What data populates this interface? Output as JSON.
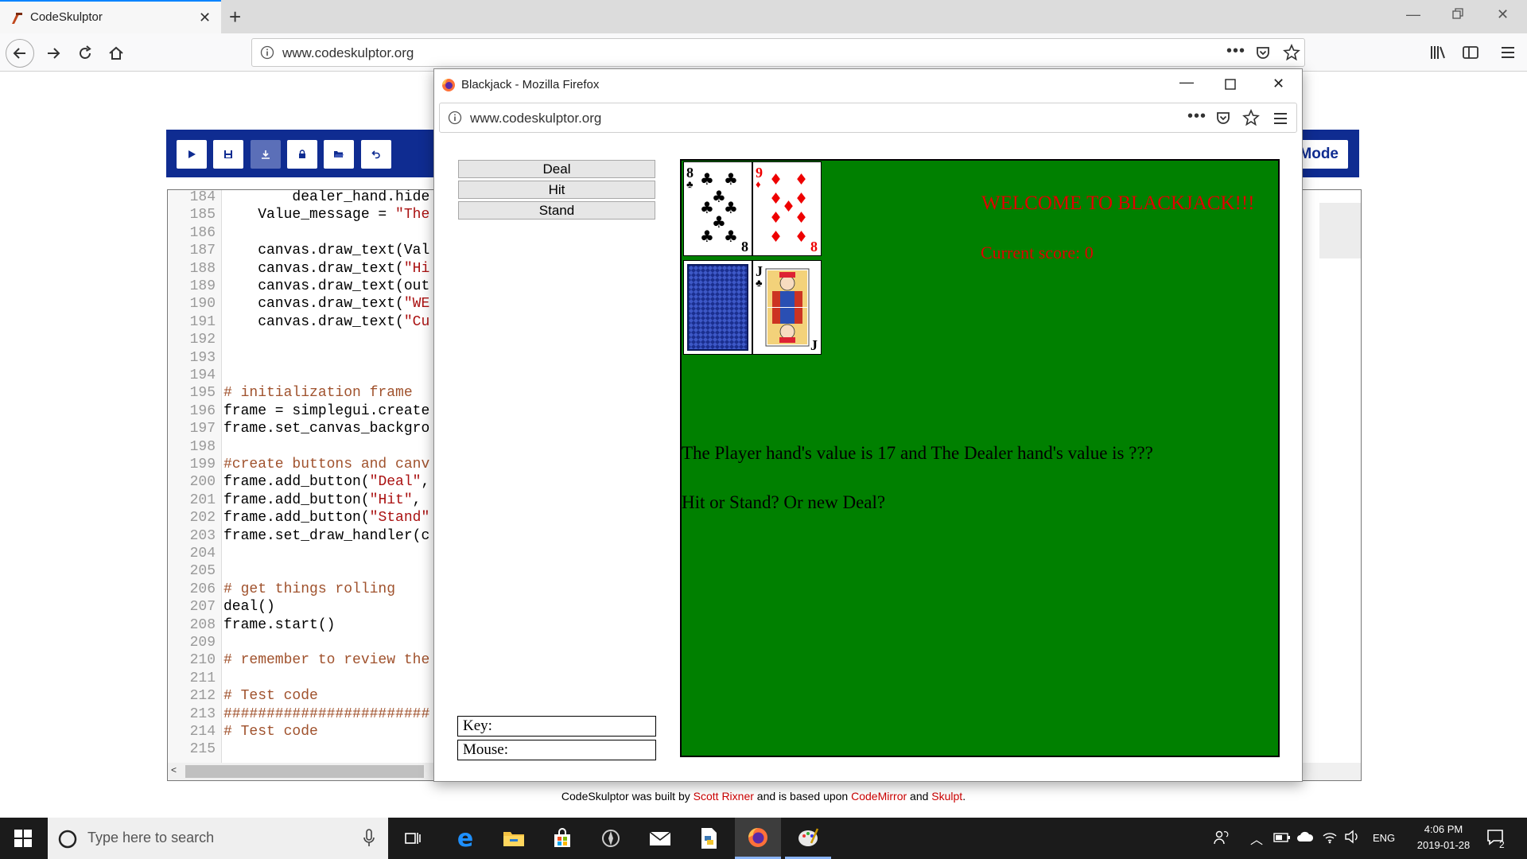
{
  "browser": {
    "tab_title": "CodeSkulptor",
    "url": "www.codeskulptor.org"
  },
  "codeskulptor": {
    "mode_label": "Mode",
    "toolbar_icons": [
      "run-icon",
      "save-icon",
      "download-icon",
      "lock-icon",
      "open-folder-icon",
      "undo-icon"
    ],
    "code_lines": [
      {
        "n": "184",
        "t": "        dealer_hand.hide",
        "k": "code"
      },
      {
        "n": "185",
        "t": "    Value_message = ",
        "s": "\"The",
        "k": "code"
      },
      {
        "n": "186",
        "t": "",
        "k": "code"
      },
      {
        "n": "187",
        "t": "    canvas.draw_text(Val",
        "k": "code"
      },
      {
        "n": "188",
        "t": "    canvas.draw_text(",
        "s": "\"Hi",
        "k": "code"
      },
      {
        "n": "189",
        "t": "    canvas.draw_text(out",
        "k": "code"
      },
      {
        "n": "190",
        "t": "    canvas.draw_text(",
        "s": "\"WE",
        "k": "code"
      },
      {
        "n": "191",
        "t": "    canvas.draw_text(",
        "s": "\"Cu",
        "k": "code"
      },
      {
        "n": "192",
        "t": "",
        "k": "code"
      },
      {
        "n": "193",
        "t": "",
        "k": "code"
      },
      {
        "n": "194",
        "t": "",
        "k": "code"
      },
      {
        "n": "195",
        "t": "# initialization frame",
        "k": "comment"
      },
      {
        "n": "196",
        "t": "frame = simplegui.create",
        "k": "code"
      },
      {
        "n": "197",
        "t": "frame.set_canvas_backgro",
        "k": "code"
      },
      {
        "n": "198",
        "t": "",
        "k": "code"
      },
      {
        "n": "199",
        "t": "#create buttons and canv",
        "k": "comment"
      },
      {
        "n": "200",
        "t": "frame.add_button(",
        "s": "\"Deal\"",
        "r": ",",
        "k": "code"
      },
      {
        "n": "201",
        "t": "frame.add_button(",
        "s": "\"Hit\"",
        "r": ",",
        "k": "code"
      },
      {
        "n": "202",
        "t": "frame.add_button(",
        "s": "\"Stand\"",
        "k": "code"
      },
      {
        "n": "203",
        "t": "frame.set_draw_handler(c",
        "k": "code"
      },
      {
        "n": "204",
        "t": "",
        "k": "code"
      },
      {
        "n": "205",
        "t": "",
        "k": "code"
      },
      {
        "n": "206",
        "t": "# get things rolling",
        "k": "comment"
      },
      {
        "n": "207",
        "t": "deal()",
        "k": "code"
      },
      {
        "n": "208",
        "t": "frame.start()",
        "k": "code"
      },
      {
        "n": "209",
        "t": "",
        "k": "code"
      },
      {
        "n": "210",
        "t": "# remember to review the",
        "k": "comment"
      },
      {
        "n": "211",
        "t": "",
        "k": "code"
      },
      {
        "n": "212",
        "t": "# Test code",
        "k": "comment"
      },
      {
        "n": "213",
        "t": "########################",
        "k": "comment"
      },
      {
        "n": "214",
        "t": "# Test code",
        "k": "comment"
      },
      {
        "n": "215",
        "t": "",
        "k": "code"
      }
    ],
    "footer": {
      "part1": "CodeSkulptor was built by ",
      "link1": "Scott Rixner",
      "part2": " and is based upon ",
      "link2": "CodeMirror",
      "part3": " and ",
      "link3": "Skulpt",
      "part4": "."
    }
  },
  "popup": {
    "title": "Blackjack - Mozilla Firefox",
    "url": "www.codeskulptor.org",
    "buttons": {
      "deal": "Deal",
      "hit": "Hit",
      "stand": "Stand"
    },
    "key_label": "Key:",
    "mouse_label": "Mouse:",
    "canvas": {
      "background": "#008000",
      "welcome": "WELCOME TO BLACKJACK!!!",
      "score": "Current score: 0",
      "value_message": "The Player hand's value is 17 and The Dealer hand's value is ???",
      "prompt": "Hit or Stand? Or new Deal?",
      "player_cards": [
        {
          "rank": "8",
          "suit": "♣"
        },
        {
          "rank": "9",
          "suit": "♦"
        }
      ],
      "dealer_cards": [
        {
          "rank": "back",
          "suit": ""
        },
        {
          "rank": "J",
          "suit": "♣"
        }
      ]
    }
  },
  "taskbar": {
    "search_placeholder": "Type here to search",
    "lang": "ENG",
    "time": "4:06 PM",
    "date": "2019-01-28",
    "notifications": "2"
  }
}
